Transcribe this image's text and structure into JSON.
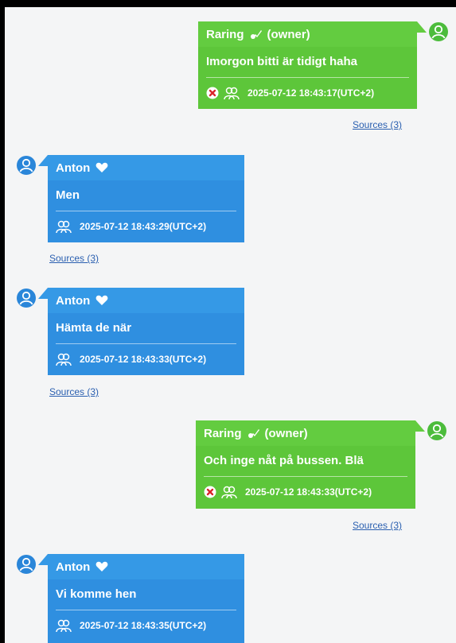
{
  "messages": [
    {
      "sender": "Raring",
      "tag": "(owner)",
      "text": "Imorgon bitti är tidigt haha",
      "timestamp": "2025-07-12 18:43:17(UTC+2)",
      "sources": "Sources (3)",
      "side": "right"
    },
    {
      "sender": "Anton",
      "tag": "",
      "text": "Men",
      "timestamp": "2025-07-12 18:43:29(UTC+2)",
      "sources": "Sources (3)",
      "side": "left"
    },
    {
      "sender": "Anton",
      "tag": "",
      "text": "Hämta de när",
      "timestamp": "2025-07-12 18:43:33(UTC+2)",
      "sources": "Sources (3)",
      "side": "left"
    },
    {
      "sender": "Raring",
      "tag": "(owner)",
      "text": "Och inge nåt på bussen. Blä",
      "timestamp": "2025-07-12 18:43:33(UTC+2)",
      "sources": "Sources (3)",
      "side": "right"
    },
    {
      "sender": "Anton",
      "tag": "",
      "text": "Vi komme hen",
      "timestamp": "2025-07-12 18:43:35(UTC+2)",
      "sources": "",
      "side": "left"
    }
  ],
  "colors": {
    "green": "#5dc63a",
    "blue": "#2f8fe0",
    "link": "#2a5fb0"
  },
  "icons": {
    "avatar": "user-icon",
    "owner": "owner-badge-icon",
    "friend": "heart-icon",
    "deleted": "x-circle-icon",
    "participants": "participants-icon"
  }
}
